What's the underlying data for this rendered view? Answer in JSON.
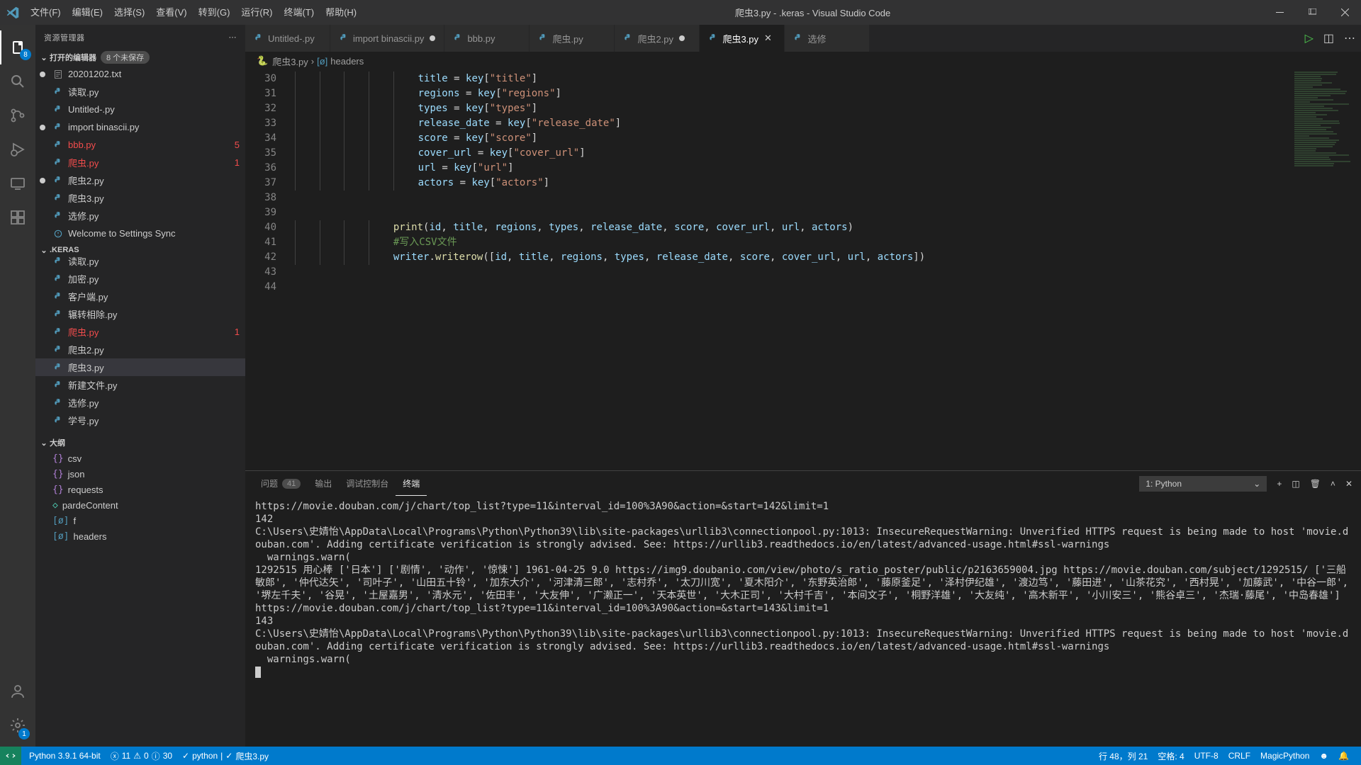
{
  "window": {
    "title": "爬虫3.py - .keras - Visual Studio Code"
  },
  "menu": [
    "文件(F)",
    "编辑(E)",
    "选择(S)",
    "查看(V)",
    "转到(G)",
    "运行(R)",
    "终端(T)",
    "帮助(H)"
  ],
  "sidebar": {
    "title": "资源管理器",
    "openEditors": {
      "label": "打开的编辑器",
      "badge": "8 个未保存"
    },
    "openItems": [
      {
        "label": "20201202.txt",
        "dirty": true,
        "icon": "text"
      },
      {
        "label": "读取.py",
        "icon": "py"
      },
      {
        "label": "Untitled-.py",
        "icon": "py"
      },
      {
        "label": "import binascii.py",
        "dirty": true,
        "icon": "py"
      },
      {
        "label": "bbb.py",
        "icon": "py",
        "error": "5"
      },
      {
        "label": "爬虫.py",
        "icon": "py",
        "error": "1"
      },
      {
        "label": "爬虫2.py",
        "dirty": true,
        "icon": "py"
      },
      {
        "label": "爬虫3.py",
        "icon": "py"
      },
      {
        "label": "选修.py",
        "icon": "py"
      },
      {
        "label": "Welcome to Settings Sync",
        "icon": "info"
      }
    ],
    "folderName": ".KERAS",
    "folderItems": [
      {
        "label": "读取.py",
        "icon": "py",
        "partial": true
      },
      {
        "label": "加密.py",
        "icon": "py"
      },
      {
        "label": "客户端.py",
        "icon": "py"
      },
      {
        "label": "辗转相除.py",
        "icon": "py"
      },
      {
        "label": "爬虫.py",
        "icon": "py",
        "error": "1"
      },
      {
        "label": "爬虫2.py",
        "icon": "py"
      },
      {
        "label": "爬虫3.py",
        "icon": "py",
        "selected": true
      },
      {
        "label": "新建文件.py",
        "icon": "py"
      },
      {
        "label": "选修.py",
        "icon": "py"
      },
      {
        "label": "学号.py",
        "icon": "py"
      }
    ],
    "outlineLabel": "大纲",
    "outline": [
      {
        "sym": "{}",
        "label": "csv"
      },
      {
        "sym": "{}",
        "label": "json"
      },
      {
        "sym": "{}",
        "label": "requests"
      },
      {
        "sym": "◇",
        "label": "pardeContent",
        "color": "#4ec9b0"
      },
      {
        "sym": "[ø]",
        "label": "f",
        "color": "#519aba"
      },
      {
        "sym": "[ø]",
        "label": "headers",
        "color": "#519aba"
      }
    ]
  },
  "tabs": [
    {
      "label": "Untitled-.py",
      "icon": "py"
    },
    {
      "label": "import binascii.py",
      "icon": "py",
      "dirty": true
    },
    {
      "label": "bbb.py",
      "icon": "py"
    },
    {
      "label": "爬虫.py",
      "icon": "py"
    },
    {
      "label": "爬虫2.py",
      "icon": "py",
      "dirty": true
    },
    {
      "label": "爬虫3.py",
      "icon": "py",
      "active": true,
      "close": true
    },
    {
      "label": "选修",
      "icon": "py"
    }
  ],
  "breadcrumb": {
    "file": "爬虫3.py",
    "symbol": "headers"
  },
  "code": {
    "startLine": 30,
    "lines": [
      {
        "indent": 5,
        "tokens": [
          [
            "var",
            "title"
          ],
          [
            "op",
            " = "
          ],
          [
            "var",
            "key"
          ],
          [
            "pun",
            "["
          ],
          [
            "str",
            "\"title\""
          ],
          [
            "pun",
            "]"
          ]
        ]
      },
      {
        "indent": 5,
        "tokens": [
          [
            "var",
            "regions"
          ],
          [
            "op",
            " = "
          ],
          [
            "var",
            "key"
          ],
          [
            "pun",
            "["
          ],
          [
            "str",
            "\"regions\""
          ],
          [
            "pun",
            "]"
          ]
        ]
      },
      {
        "indent": 5,
        "tokens": [
          [
            "var",
            "types"
          ],
          [
            "op",
            " = "
          ],
          [
            "var",
            "key"
          ],
          [
            "pun",
            "["
          ],
          [
            "str",
            "\"types\""
          ],
          [
            "pun",
            "]"
          ]
        ]
      },
      {
        "indent": 5,
        "tokens": [
          [
            "var",
            "release_date"
          ],
          [
            "op",
            " = "
          ],
          [
            "var",
            "key"
          ],
          [
            "pun",
            "["
          ],
          [
            "str",
            "\"release_date\""
          ],
          [
            "pun",
            "]"
          ]
        ]
      },
      {
        "indent": 5,
        "tokens": [
          [
            "var",
            "score"
          ],
          [
            "op",
            " = "
          ],
          [
            "var",
            "key"
          ],
          [
            "pun",
            "["
          ],
          [
            "str",
            "\"score\""
          ],
          [
            "pun",
            "]"
          ]
        ]
      },
      {
        "indent": 5,
        "tokens": [
          [
            "var",
            "cover_url"
          ],
          [
            "op",
            " = "
          ],
          [
            "var",
            "key"
          ],
          [
            "pun",
            "["
          ],
          [
            "str",
            "\"cover_url\""
          ],
          [
            "pun",
            "]"
          ]
        ]
      },
      {
        "indent": 5,
        "tokens": [
          [
            "var",
            "url"
          ],
          [
            "op",
            " = "
          ],
          [
            "var",
            "key"
          ],
          [
            "pun",
            "["
          ],
          [
            "str",
            "\"url\""
          ],
          [
            "pun",
            "]"
          ]
        ]
      },
      {
        "indent": 5,
        "tokens": [
          [
            "var",
            "actors"
          ],
          [
            "op",
            " = "
          ],
          [
            "var",
            "key"
          ],
          [
            "pun",
            "["
          ],
          [
            "str",
            "\"actors\""
          ],
          [
            "pun",
            "]"
          ]
        ]
      },
      {
        "indent": 0,
        "tokens": []
      },
      {
        "indent": 0,
        "tokens": []
      },
      {
        "indent": 4,
        "tokens": [
          [
            "fn",
            "print"
          ],
          [
            "pun",
            "("
          ],
          [
            "var",
            "id"
          ],
          [
            "pun",
            ", "
          ],
          [
            "var",
            "title"
          ],
          [
            "pun",
            ", "
          ],
          [
            "var",
            "regions"
          ],
          [
            "pun",
            ", "
          ],
          [
            "var",
            "types"
          ],
          [
            "pun",
            ", "
          ],
          [
            "var",
            "release_date"
          ],
          [
            "pun",
            ", "
          ],
          [
            "var",
            "score"
          ],
          [
            "pun",
            ", "
          ],
          [
            "var",
            "cover_url"
          ],
          [
            "pun",
            ", "
          ],
          [
            "var",
            "url"
          ],
          [
            "pun",
            ", "
          ],
          [
            "var",
            "actors"
          ],
          [
            "pun",
            ")"
          ]
        ]
      },
      {
        "indent": 4,
        "tokens": [
          [
            "com",
            "#写入CSV文件"
          ]
        ]
      },
      {
        "indent": 4,
        "tokens": [
          [
            "var",
            "writer"
          ],
          [
            "pun",
            "."
          ],
          [
            "fn",
            "writerow"
          ],
          [
            "pun",
            "(["
          ],
          [
            "var",
            "id"
          ],
          [
            "pun",
            ", "
          ],
          [
            "var",
            "title"
          ],
          [
            "pun",
            ", "
          ],
          [
            "var",
            "regions"
          ],
          [
            "pun",
            ", "
          ],
          [
            "var",
            "types"
          ],
          [
            "pun",
            ", "
          ],
          [
            "var",
            "release_date"
          ],
          [
            "pun",
            ", "
          ],
          [
            "var",
            "score"
          ],
          [
            "pun",
            ", "
          ],
          [
            "var",
            "cover_url"
          ],
          [
            "pun",
            ", "
          ],
          [
            "var",
            "url"
          ],
          [
            "pun",
            ", "
          ],
          [
            "var",
            "actors"
          ],
          [
            "pun",
            "])"
          ]
        ]
      },
      {
        "indent": 0,
        "tokens": []
      },
      {
        "indent": 0,
        "tokens": []
      }
    ]
  },
  "panel": {
    "tabs": {
      "problems": "问题",
      "problemsCount": "41",
      "output": "输出",
      "debug": "调试控制台",
      "terminal": "终端"
    },
    "terminalSelect": "1: Python",
    "output": "https://movie.douban.com/j/chart/top_list?type=11&interval_id=100%3A90&action=&start=142&limit=1\n142\nC:\\Users\\史婧怡\\AppData\\Local\\Programs\\Python\\Python39\\lib\\site-packages\\urllib3\\connectionpool.py:1013: InsecureRequestWarning: Unverified HTTPS request is being made to host 'movie.douban.com'. Adding certificate verification is strongly advised. See: https://urllib3.readthedocs.io/en/latest/advanced-usage.html#ssl-warnings\n  warnings.warn(\n1292515 用心棒 ['日本'] ['剧情', '动作', '惊悚'] 1961-04-25 9.0 https://img9.doubanio.com/view/photo/s_ratio_poster/public/p2163659004.jpg https://movie.douban.com/subject/1292515/ ['三船敏郎', '仲代达矢', '司叶子', '山田五十铃', '加东大介', '河津清三郎', '志村乔', '太刀川宽', '夏木阳介', '东野英治郎', '藤原釜足', '泽村伊纪雄', '渡边笃', '藤田进', '山茶花究', '西村晃', '加藤武', '中谷一郎', '堺左千夫', '谷晃', '土屋嘉男', '清水元', '佐田丰', '大友伸', '广濑正一', '天本英世', '大木正司', '大村千吉', '本间文子', '桐野洋雄', '大友纯', '高木新平', '小川安三', '熊谷卓三', '杰瑞·藤尾', '中岛春雄']\nhttps://movie.douban.com/j/chart/top_list?type=11&interval_id=100%3A90&action=&start=143&limit=1\n143\nC:\\Users\\史婧怡\\AppData\\Local\\Programs\\Python\\Python39\\lib\\site-packages\\urllib3\\connectionpool.py:1013: InsecureRequestWarning: Unverified HTTPS request is being made to host 'movie.douban.com'. Adding certificate verification is strongly advised. See: https://urllib3.readthedocs.io/en/latest/advanced-usage.html#ssl-warnings\n  warnings.warn("
  },
  "statusbar": {
    "python": "Python 3.9.1 64-bit",
    "errors": "11",
    "warnings": "0",
    "info": "30",
    "check": "python",
    "fileCheck": "爬虫3.py",
    "line": "行 48，列 21",
    "spaces": "空格: 4",
    "enc": "UTF-8",
    "eol": "CRLF",
    "lang": "MagicPython"
  },
  "activityBadge": "8"
}
